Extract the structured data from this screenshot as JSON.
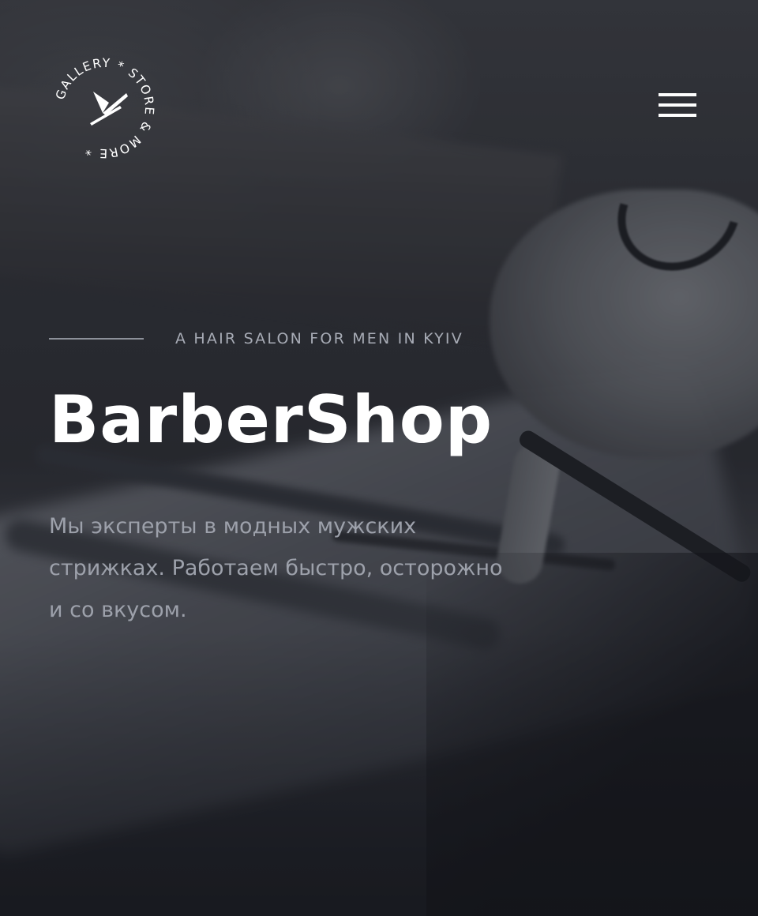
{
  "header": {
    "logo": {
      "ring_text": "GALLERY * STORE & MORE *",
      "icon": "razor-icon"
    },
    "menu": {
      "icon": "hamburger-menu-icon"
    }
  },
  "hero": {
    "tagline": "A HAIR SALON FOR MEN IN KYIV",
    "title": "BarberShop",
    "description": "Мы эксперты в модных мужских стрижках. Работаем быстро, осторожно и со вкусом."
  },
  "colors": {
    "title": "#ffffff",
    "tagline": "#a7abb5",
    "description": "#9da1ab",
    "overlay": "#1c202c"
  }
}
